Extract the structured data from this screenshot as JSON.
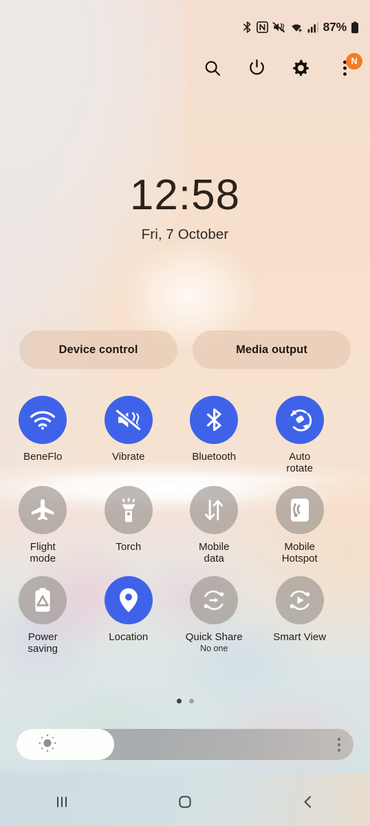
{
  "statusbar": {
    "icons": [
      "bluetooth-icon",
      "nfc-icon",
      "mute-vibrate-icon",
      "wifi-icon",
      "signal-icon"
    ],
    "battery_percent": "87%",
    "battery_icon": "battery-icon"
  },
  "header": {
    "buttons": [
      {
        "name": "search-icon",
        "label": "Search"
      },
      {
        "name": "power-icon",
        "label": "Power"
      },
      {
        "name": "settings-icon",
        "label": "Settings"
      },
      {
        "name": "more-options-icon",
        "label": "More options",
        "badge": "N",
        "badge_color": "#f47b20"
      }
    ]
  },
  "clock": {
    "time": "12:58",
    "date": "Fri, 7 October"
  },
  "pills": {
    "device_control": "Device control",
    "media_output": "Media output"
  },
  "colors": {
    "active_tile": "#3f63e8",
    "inactive_tile": "#968f8a",
    "badge": "#f47b20"
  },
  "tiles": [
    [
      {
        "label": "BeneFlo",
        "icon": "wifi-icon",
        "state": "on"
      },
      {
        "label": "Vibrate",
        "icon": "vibrate-icon",
        "state": "on"
      },
      {
        "label": "Bluetooth",
        "icon": "bluetooth-icon",
        "state": "on"
      },
      {
        "label": "Auto\nrotate",
        "icon": "auto-rotate-icon",
        "state": "on"
      }
    ],
    [
      {
        "label": "Flight\nmode",
        "icon": "airplane-icon",
        "state": "off"
      },
      {
        "label": "Torch",
        "icon": "flashlight-icon",
        "state": "off"
      },
      {
        "label": "Mobile\ndata",
        "icon": "mobile-data-icon",
        "state": "off"
      },
      {
        "label": "Mobile\nHotspot",
        "icon": "hotspot-icon",
        "state": "off"
      }
    ],
    [
      {
        "label": "Power\nsaving",
        "icon": "battery-saver-icon",
        "state": "off"
      },
      {
        "label": "Location",
        "icon": "location-pin-icon",
        "state": "on"
      },
      {
        "label": "Quick Share",
        "icon": "quick-share-icon",
        "state": "off",
        "sub": "No one"
      },
      {
        "label": "Smart View",
        "icon": "smart-view-icon",
        "state": "off"
      }
    ]
  ],
  "pager": {
    "total": 2,
    "active_index": 0
  },
  "brightness": {
    "value_percent": 29,
    "sun_icon": "brightness-sun-icon",
    "menu_icon": "brightness-more-icon"
  },
  "navbar": {
    "recents": "recents-icon",
    "home": "home-icon",
    "back": "back-icon"
  }
}
